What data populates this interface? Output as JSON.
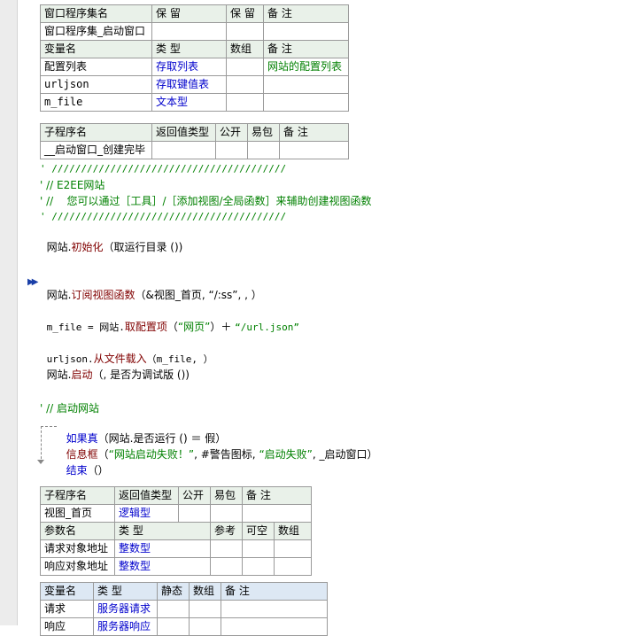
{
  "table_window_set": {
    "headers": [
      "窗口程序集名",
      "保 留",
      "保 留",
      "备 注"
    ],
    "row": [
      "窗口程序集_启动窗口",
      "",
      "",
      ""
    ]
  },
  "table_vars": {
    "headers": [
      "变量名",
      "类 型",
      "数组",
      "备 注"
    ],
    "rows": [
      [
        "配置列表",
        "存取列表",
        "",
        "网站的配置列表"
      ],
      [
        "urljson",
        "存取键值表",
        "",
        ""
      ],
      [
        "m_file",
        "文本型",
        "",
        ""
      ]
    ]
  },
  "table_sub1": {
    "headers": [
      "子程序名",
      "返回值类型",
      "公开",
      "易包",
      "备 注"
    ],
    "row": [
      "__启动窗口_创建完毕",
      "",
      "",
      "",
      ""
    ]
  },
  "code": {
    "c1": "' ////////////////////////////////////////",
    "c2": "' // E2EE网站",
    "c3": "' //    您可以通过［工具］/［添加视图/全局函数］来辅助创建视图函数",
    "c4": "' ////////////////////////////////////////",
    "l5_obj": "网站.",
    "l5_method": "初始化",
    "l5_rest": "（取运行目录 ())",
    "l6_obj": "网站.",
    "l6_method": "订阅视图函数",
    "l6_rest": "（&视图_首页, “/:ss”, , ）",
    "l7_a": "m_file = 网站.",
    "l7_method": "取配置项",
    "l7_b": "（",
    "l7_s1": "“网页”",
    "l7_c": "）＋ ",
    "l7_s2": "“/url.json”",
    "l8_obj": "urljson.",
    "l8_method": "从文件载入",
    "l8_rest": "（m_file, ）",
    "l9_obj": "网站.",
    "l9_method": "启动",
    "l9_rest": "（, 是否为调试版 ())",
    "c10": "' // 启动网站",
    "l11_kw": "如果真",
    "l11_rest": "（网站.是否运行 () ＝ 假）",
    "l12_kw": "信息框",
    "l12_b": "（",
    "l12_s1": "“网站启动失败！”",
    "l12_c": ", #警告图标, ",
    "l12_s2": "“启动失败”",
    "l12_d": ", _启动窗口）",
    "l13_kw": "结束",
    "l13_rest": "（）"
  },
  "table_sub2": {
    "headers": [
      "子程序名",
      "返回值类型",
      "公开",
      "易包",
      "备 注"
    ],
    "row": [
      "视图_首页",
      "逻辑型",
      "",
      "",
      ""
    ]
  },
  "table_params": {
    "headers": [
      "参数名",
      "类 型",
      "参考",
      "可空",
      "数组",
      "备 注"
    ],
    "rows": [
      [
        "请求对象地址",
        "整数型",
        "",
        "",
        "",
        ""
      ],
      [
        "响应对象地址",
        "整数型",
        "",
        "",
        "",
        ""
      ]
    ]
  },
  "table_locals": {
    "headers": [
      "变量名",
      "类 型",
      "静态",
      "数组",
      "备 注"
    ],
    "rows": [
      [
        "请求",
        "服务器请求",
        "",
        "",
        ""
      ],
      [
        "响应",
        "服务器响应",
        "",
        "",
        ""
      ]
    ]
  }
}
